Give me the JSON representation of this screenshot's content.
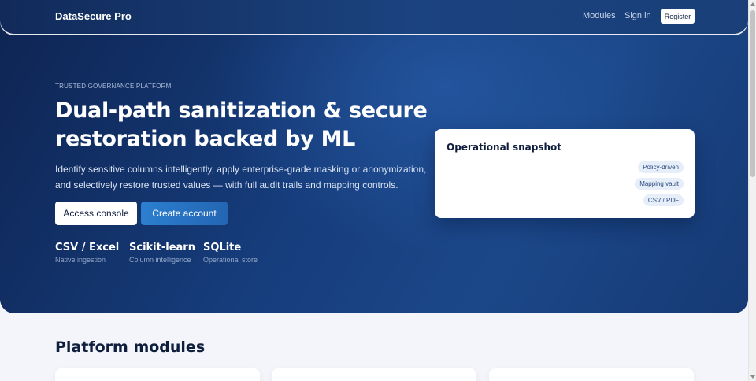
{
  "nav": {
    "brand": "DataSecure Pro",
    "links": [
      "Modules",
      "Sign in"
    ],
    "register_label": "Register"
  },
  "hero": {
    "eyebrow": "TRUSTED GOVERNANCE PLATFORM",
    "title": "Dual-path sanitization & secure restoration backed by ML",
    "description": "Identify sensitive columns intelligently, apply enterprise-grade masking or anonymization, and selectively restore trusted values — with full audit trails and mapping controls.",
    "primary_button": "Access console",
    "secondary_button": "Create account",
    "stats": [
      {
        "title": "CSV / Excel",
        "subtitle": "Native ingestion"
      },
      {
        "title": "Scikit-learn",
        "subtitle": "Column intelligence"
      },
      {
        "title": "SQLite",
        "subtitle": "Operational store"
      }
    ]
  },
  "snapshot": {
    "title": "Operational snapshot",
    "chips": [
      "Policy-driven",
      "Mapping vault",
      "CSV / PDF"
    ]
  },
  "modules": {
    "title": "Platform modules"
  },
  "colors": {
    "hero_dark": "#0e2452",
    "hero_mid": "#1b4789",
    "accent": "#2c7fd0",
    "page_bg": "#f3f5fa"
  }
}
